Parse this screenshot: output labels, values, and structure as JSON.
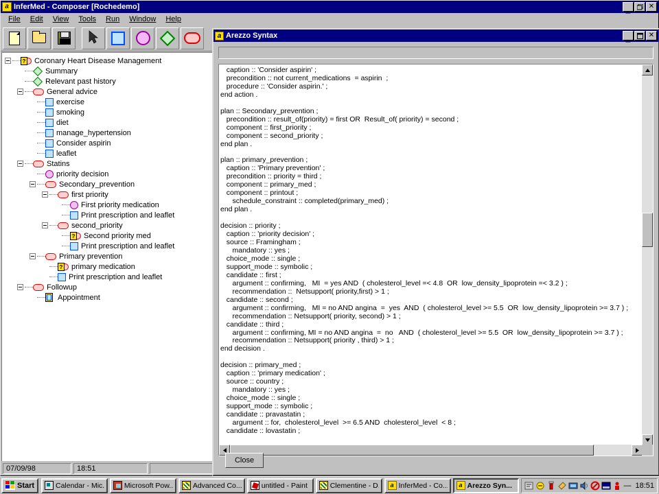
{
  "window": {
    "title": "InferMed - Composer [Rochedemo]",
    "icon": "alpha-icon",
    "buttons": {
      "minimize": "minimize-icon",
      "restore": "restore-icon",
      "close": "close-icon"
    }
  },
  "menubar": {
    "items": [
      {
        "label": "File",
        "accel": "F"
      },
      {
        "label": "Edit",
        "accel": "E"
      },
      {
        "label": "View",
        "accel": "V"
      },
      {
        "label": "Tools",
        "accel": "T"
      },
      {
        "label": "Run",
        "accel": "R"
      },
      {
        "label": "Window",
        "accel": "W"
      },
      {
        "label": "Help",
        "accel": "H"
      }
    ]
  },
  "toolbar": {
    "buttons": [
      {
        "name": "new-document-button",
        "icon": "new-document-icon"
      },
      {
        "name": "open-folder-button",
        "icon": "open-folder-icon"
      },
      {
        "name": "save-button",
        "icon": "floppy-disk-icon"
      },
      {
        "name": "select-pointer-button",
        "icon": "arrow-pointer-icon"
      },
      {
        "name": "action-node-button",
        "icon": "blue-square-icon"
      },
      {
        "name": "decision-node-button",
        "icon": "magenta-circle-icon"
      },
      {
        "name": "enquiry-node-button",
        "icon": "green-diamond-icon"
      },
      {
        "name": "plan-node-button",
        "icon": "red-rounded-rect-icon"
      }
    ]
  },
  "tree": {
    "nodes": [
      {
        "label": "Coronary Heart Disease Management",
        "icon": "query-plan-icon",
        "depth": 0,
        "expander": "collapse"
      },
      {
        "label": "Summary",
        "icon": "green-diamond-icon",
        "depth": 1,
        "expander": "none"
      },
      {
        "label": "Relevant past history",
        "icon": "green-diamond-icon",
        "depth": 1,
        "expander": "none"
      },
      {
        "label": "General advice",
        "icon": "red-rounded-rect-icon",
        "depth": 1,
        "expander": "collapse"
      },
      {
        "label": "exercise",
        "icon": "blue-square-icon",
        "depth": 2,
        "expander": "none"
      },
      {
        "label": "smoking",
        "icon": "blue-square-icon",
        "depth": 2,
        "expander": "none"
      },
      {
        "label": "diet",
        "icon": "blue-square-icon",
        "depth": 2,
        "expander": "none"
      },
      {
        "label": "manage_hypertension",
        "icon": "blue-square-icon",
        "depth": 2,
        "expander": "none"
      },
      {
        "label": "Consider aspirin",
        "icon": "blue-square-icon",
        "depth": 2,
        "expander": "none"
      },
      {
        "label": "leaflet",
        "icon": "blue-square-icon",
        "depth": 2,
        "expander": "none"
      },
      {
        "label": "Statins",
        "icon": "red-rounded-rect-icon",
        "depth": 1,
        "expander": "collapse"
      },
      {
        "label": "priority decision",
        "icon": "magenta-circle-icon",
        "depth": 2,
        "expander": "none"
      },
      {
        "label": "Secondary_prevention",
        "icon": "red-rounded-rect-icon",
        "depth": 2,
        "expander": "collapse"
      },
      {
        "label": "first priority",
        "icon": "red-rounded-rect-icon",
        "depth": 3,
        "expander": "collapse"
      },
      {
        "label": "First priority medication",
        "icon": "magenta-circle-icon",
        "depth": 4,
        "expander": "none"
      },
      {
        "label": "Print prescription and leaflet",
        "icon": "blue-square-icon",
        "depth": 4,
        "expander": "none"
      },
      {
        "label": "second_priority",
        "icon": "red-rounded-rect-icon",
        "depth": 3,
        "expander": "collapse"
      },
      {
        "label": "Second priority med",
        "icon": "query-decision-icon",
        "depth": 4,
        "expander": "none"
      },
      {
        "label": "Print prescription and leaflet",
        "icon": "blue-square-icon",
        "depth": 4,
        "expander": "none"
      },
      {
        "label": "Primary prevention",
        "icon": "red-rounded-rect-icon",
        "depth": 2,
        "expander": "collapse"
      },
      {
        "label": "primary medication",
        "icon": "query-decision-icon",
        "depth": 3,
        "expander": "none"
      },
      {
        "label": "Print prescription and leaflet",
        "icon": "blue-square-icon",
        "depth": 3,
        "expander": "none"
      },
      {
        "label": "Followup",
        "icon": "red-rounded-rect-icon",
        "depth": 1,
        "expander": "collapse"
      },
      {
        "label": "Appointment",
        "icon": "query-action-icon",
        "depth": 2,
        "expander": "none"
      }
    ]
  },
  "statusbar": {
    "date": "07/09/98",
    "time": "18:51",
    "extra": ""
  },
  "child_window": {
    "title": "Arezzo Syntax",
    "icon": "alpha-icon",
    "buttons": {
      "minimize": "minimize-icon",
      "maximize": "maximize-icon",
      "close": "close-icon"
    },
    "search_field_value": "",
    "close_button_label": "Close",
    "code": "   caption :: 'Consider aspirin' ;\n   precondition :: not current_medications  = aspirin  ;\n   procedure :: 'Consider aspirin.' ;\nend action .\n\nplan :: Secondary_prevention ;\n   precondition :: result_of(priority) = first OR  Result_of( priority) = second ;\n   component :: first_priority ;\n   component :: second_priority ;\nend plan .\n\nplan :: primary_prevention ;\n   caption :: 'Primary prevention' ;\n   precondition :: priority = third ;\n   component :: primary_med ;\n   component :: printout ;\n      schedule_constraint :: completed(primary_med) ;\nend plan .\n\ndecision :: priority ;\n   caption :: 'priority decision' ;\n   source :: Framingham ;\n      mandatory :: yes ;\n   choice_mode :: single ;\n   support_mode :: symbolic ;\n   candidate :: first ;\n      argument :: confirming,   MI  = yes AND  ( cholesterol_level =< 4.8  OR  low_density_lipoprotein =< 3.2 ) ;\n      recommendation ::  Netsupport( priority,first) > 1 ;\n   candidate :: second ;\n      argument :: confirming,   MI = no AND angina  =  yes  AND  ( cholesterol_level >= 5.5  OR  low_density_lipoprotein >= 3.7 ) ;\n      recommendation :: Netsupport( priority, second) > 1 ;\n   candidate :: third ;\n      argument :: confirming, MI = no AND angina  =  no   AND  ( cholesterol_level >= 5.5  OR  low_density_lipoprotein >= 3.7 ) ;\n      recommendation :: Netsupport( priority , third) > 1 ;\nend decision .\n\ndecision :: primary_med ;\n   caption :: 'primary medication' ;\n   source :: country ;\n      mandatory :: yes ;\n   choice_mode :: single ;\n   support_mode :: symbolic ;\n   candidate :: pravastatin ;\n      argument :: for,  cholesterol_level  >= 6.5 AND  cholesterol_level  < 8 ;\n   candidate :: lovastatin ;"
  },
  "taskbar": {
    "start_label": "Start",
    "items": [
      {
        "label": "Calendar - Mic...",
        "icon": "calendar-icon",
        "active": false
      },
      {
        "label": "Microsoft Pow...",
        "icon": "powerpoint-icon",
        "active": false
      },
      {
        "label": "Advanced Co...",
        "icon": "clementine-icon",
        "active": false
      },
      {
        "label": "untitled - Paint",
        "icon": "paint-icon",
        "active": false
      },
      {
        "label": "Clementine - D...",
        "icon": "clementine-icon",
        "active": false
      },
      {
        "label": "InferMed - Co...",
        "icon": "alpha-icon",
        "active": false
      },
      {
        "label": "Arezzo Syn...",
        "icon": "alpha-icon",
        "active": true
      }
    ],
    "tray": {
      "icons": [
        "tray-icon-1",
        "tray-icon-2",
        "tray-icon-3",
        "tray-icon-4",
        "tray-icon-5",
        "tray-icon-6",
        "tray-icon-7",
        "tray-icon-8",
        "tray-icon-9"
      ],
      "clock": "18:51"
    }
  },
  "colors": {
    "titlebar": "#000080",
    "face": "#c0c0c0",
    "action_blue": "#0050ff",
    "decision_magenta": "#a000a0",
    "enquiry_green": "#008000",
    "plan_red": "#e00000",
    "query_yellow": "#ffe000"
  }
}
